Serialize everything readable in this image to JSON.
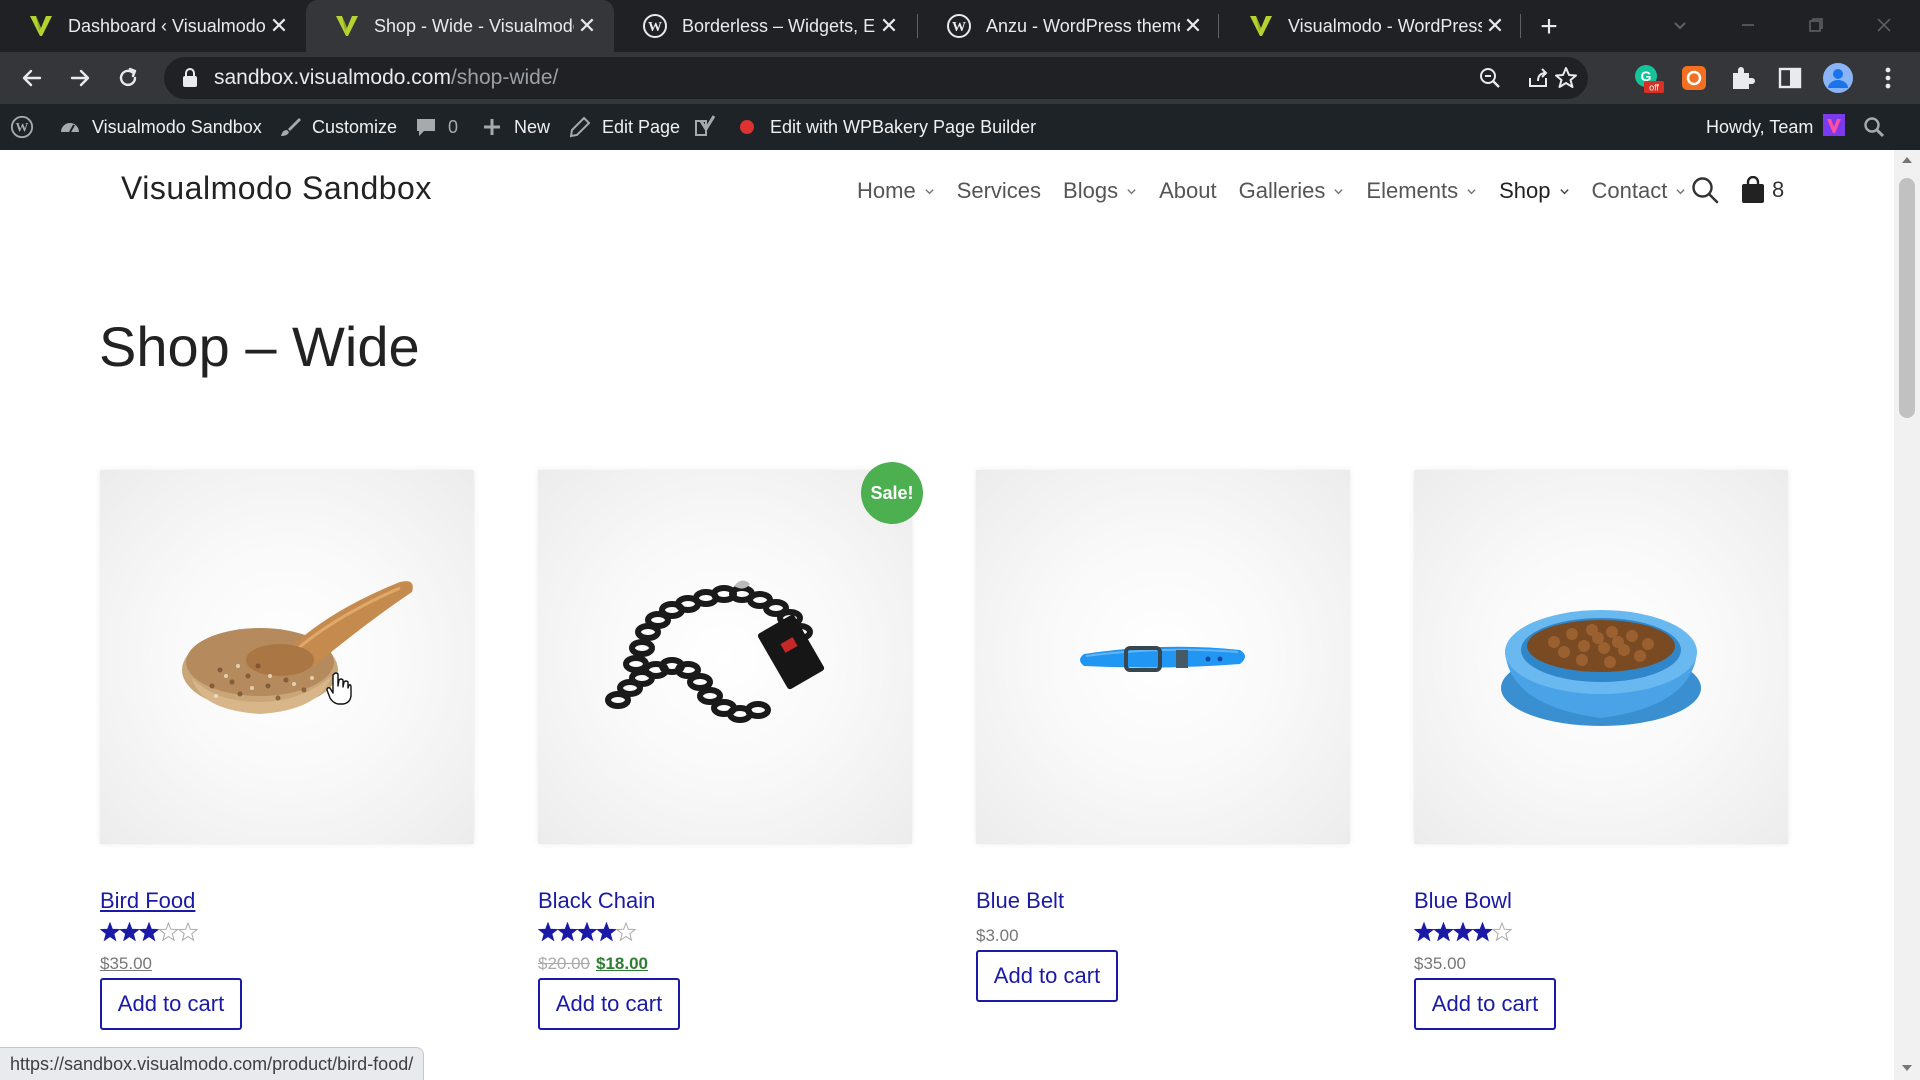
{
  "browser": {
    "tabs": [
      {
        "title": "Dashboard ‹ Visualmodo",
        "favicon": "visualmodo-icon",
        "active": false
      },
      {
        "title": "Shop - Wide - Visualmodo",
        "favicon": "visualmodo-icon",
        "active": true
      },
      {
        "title": "Borderless – Widgets, Ele",
        "favicon": "wordpress-icon",
        "active": false
      },
      {
        "title": "Anzu - WordPress theme",
        "favicon": "wordpress-icon",
        "active": false
      },
      {
        "title": "Visualmodo - WordPress",
        "favicon": "visualmodo-icon",
        "active": false
      }
    ],
    "tab_close_glyph": "✕",
    "new_tab_glyph": "+",
    "url": {
      "host": "sandbox.visualmodo.com",
      "path": "/shop-wide/"
    },
    "extension_badge": "off",
    "status_url": "https://sandbox.visualmodo.com/product/bird-food/"
  },
  "adminbar": {
    "site_name": "Visualmodo Sandbox",
    "customize": "Customize",
    "comments_count": "0",
    "new_label": "New",
    "edit_page": "Edit Page",
    "wpbakery": "Edit with WPBakery Page Builder",
    "howdy": "Howdy, Team"
  },
  "site": {
    "title": "Visualmodo Sandbox",
    "nav": [
      {
        "label": "Home",
        "has_dropdown": true
      },
      {
        "label": "Services",
        "has_dropdown": false
      },
      {
        "label": "Blogs",
        "has_dropdown": true
      },
      {
        "label": "About",
        "has_dropdown": false
      },
      {
        "label": "Galleries",
        "has_dropdown": true
      },
      {
        "label": "Elements",
        "has_dropdown": true
      },
      {
        "label": "Shop",
        "has_dropdown": true
      },
      {
        "label": "Contact",
        "has_dropdown": true
      }
    ],
    "cart_count": "8"
  },
  "page": {
    "title": "Shop – Wide"
  },
  "products": [
    {
      "name": "Bird Food",
      "rating": 3,
      "price": "$35.00",
      "button": "Add to cart"
    },
    {
      "name": "Black Chain",
      "rating": 4,
      "old_price": "$20.00",
      "price": "$18.00",
      "sale_badge": "Sale!",
      "button": "Add to cart"
    },
    {
      "name": "Blue Belt",
      "price": "$3.00",
      "button": "Add to cart"
    },
    {
      "name": "Blue Bowl",
      "rating": 4,
      "price": "$35.00",
      "button": "Add to cart"
    }
  ],
  "colors": {
    "link": "#1a1aa6",
    "sale_badge": "#4caf50",
    "admin_bar": "#1d2327",
    "browser_frame": "#202124"
  }
}
